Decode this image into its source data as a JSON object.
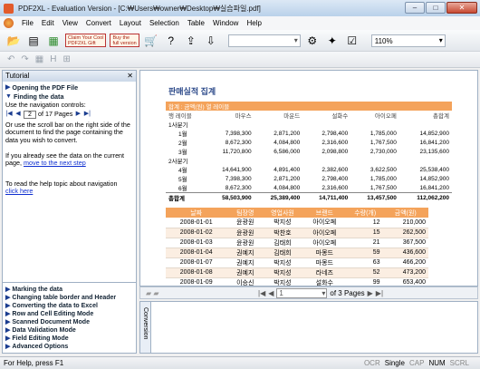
{
  "window": {
    "title": "PDF2XL - Evaluation Version - [C:₩Users₩owner₩Desktop₩실습파일.pdf]"
  },
  "menu": [
    "File",
    "Edit",
    "View",
    "Convert",
    "Layout",
    "Selection",
    "Table",
    "Window",
    "Help"
  ],
  "toolbar": {
    "ad1": "Claim Your Cool\nPDF2XL Gift",
    "ad2": "Buy the\nfull version",
    "zoom": "110%"
  },
  "tutorial": {
    "title": "Tutorial",
    "opening": "Opening the PDF File",
    "finding": "Finding the data",
    "nav_hint": "Use the navigation controls:",
    "page_value": "2",
    "page_of": "of 17 Pages",
    "scroll_hint": "Or use the scroll bar on the right side of the document to find the page containing the data you wish to convert.",
    "already_prefix": "If you already see the data on the current page,",
    "already_link": "move to the next step",
    "help_text": "To read the help topic about navigation",
    "help_link": "click here",
    "footer": [
      "Marking the data",
      "Changing table border and Header",
      "Converting the data to Excel",
      "Row and Cell Editing Mode",
      "Scanned Document Mode",
      "Data Validation Mode",
      "Field Editing Mode",
      "Advanced Options"
    ]
  },
  "doc": {
    "title": "판매실적 집계",
    "table1": {
      "header": [
        "합계 : 금액(원)  열 레이블",
        "",
        "",
        "",
        "",
        ""
      ],
      "subheader": [
        "행 레이블",
        "마우스",
        "마운드",
        "설화수",
        "아이오페",
        "총합계"
      ],
      "rows": [
        {
          "label": "1사분기",
          "vals": [
            "",
            "",
            "",
            "",
            ""
          ],
          "group": true
        },
        {
          "label": "1월",
          "vals": [
            "7,398,300",
            "2,871,200",
            "2,798,400",
            "1,785,000",
            "14,852,900"
          ]
        },
        {
          "label": "2월",
          "vals": [
            "8,672,300",
            "4,084,800",
            "2,316,600",
            "1,767,500",
            "16,841,200"
          ]
        },
        {
          "label": "3월",
          "vals": [
            "11,720,800",
            "6,586,000",
            "2,098,800",
            "2,730,000",
            "23,135,600"
          ]
        },
        {
          "label": "2사분기",
          "vals": [
            "",
            "",
            "",
            "",
            ""
          ],
          "group": true
        },
        {
          "label": "4월",
          "vals": [
            "14,641,900",
            "4,891,400",
            "2,382,600",
            "3,622,500",
            "25,538,400"
          ]
        },
        {
          "label": "5월",
          "vals": [
            "7,398,300",
            "2,871,200",
            "2,798,400",
            "1,785,000",
            "14,852,900"
          ]
        },
        {
          "label": "6월",
          "vals": [
            "8,672,300",
            "4,084,800",
            "2,316,600",
            "1,767,500",
            "16,841,200"
          ]
        }
      ],
      "total": {
        "label": "총합계",
        "vals": [
          "58,503,900",
          "25,389,400",
          "14,711,400",
          "13,457,500",
          "112,062,200"
        ]
      }
    },
    "table2": {
      "headers": [
        "날짜",
        "팀장명",
        "영업사원",
        "브랜드",
        "수량(개)",
        "금액(원)"
      ],
      "rows": [
        [
          "2008-01-01",
          "윤광원",
          "박지성",
          "아이오페",
          "12",
          "210,000"
        ],
        [
          "2008-01-02",
          "윤광원",
          "박찬호",
          "아이오페",
          "15",
          "262,500"
        ],
        [
          "2008-01-03",
          "윤광원",
          "김태희",
          "아이오페",
          "21",
          "367,500"
        ],
        [
          "2008-01-04",
          "권예지",
          "김태희",
          "마몽드",
          "59",
          "436,600"
        ],
        [
          "2008-01-07",
          "권예지",
          "박지성",
          "마몽드",
          "63",
          "466,200"
        ],
        [
          "2008-01-08",
          "권예지",
          "박지성",
          "라네즈",
          "52",
          "473,200"
        ],
        [
          "2008-01-09",
          "이승신",
          "박지성",
          "설화수",
          "99",
          "653,400"
        ],
        [
          "2008-01-10",
          "이승신",
          "박지성",
          "설화수",
          "108",
          "712,800"
        ]
      ]
    }
  },
  "pager": {
    "page": "1",
    "of": "of 3 Pages"
  },
  "conversion_tab": "Conversion",
  "status": {
    "left": "For Help, press F1",
    "ocr": "OCR",
    "single": "Single",
    "cap": "CAP",
    "num": "NUM",
    "scrl": "SCRL"
  }
}
